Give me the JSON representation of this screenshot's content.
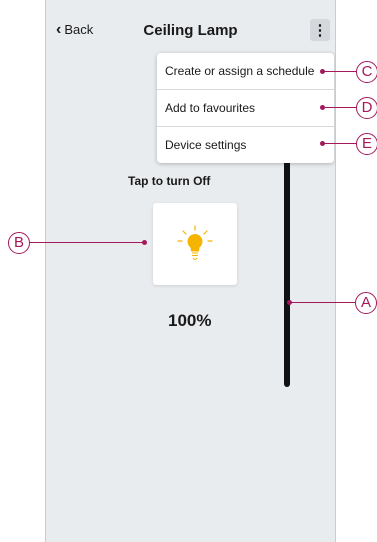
{
  "header": {
    "back_label": "Back",
    "title": "Ceiling Lamp",
    "menu_icon": "kebab-menu-icon"
  },
  "menu": {
    "items": [
      {
        "label": "Create or assign a schedule"
      },
      {
        "label": "Add to favourites"
      },
      {
        "label": "Device settings"
      }
    ]
  },
  "device": {
    "tap_label": "Tap to turn Off",
    "icon": "light-bulb-icon",
    "brightness_text": "100%",
    "brightness_level": 1.0
  },
  "callouts": {
    "a": "A",
    "b": "B",
    "c": "C",
    "d": "D",
    "e": "E"
  },
  "colors": {
    "screen_background": "#e9ecef",
    "bulb": "#f5b400",
    "slider": "#111111",
    "callout": "#a3195b"
  }
}
